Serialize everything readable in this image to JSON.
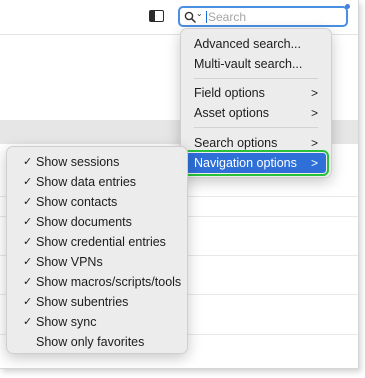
{
  "toolbar": {
    "search_placeholder": "Search",
    "search_chevron": "⌄"
  },
  "main_menu": {
    "items": [
      {
        "label": "Advanced search...",
        "submenu": false
      },
      {
        "label": "Multi-vault search...",
        "submenu": false
      },
      {
        "label": "Field options",
        "submenu": true
      },
      {
        "label": "Asset options",
        "submenu": true
      },
      {
        "label": "Search options",
        "submenu": true
      },
      {
        "label": "Navigation options",
        "submenu": true,
        "highlighted": true
      }
    ],
    "arrow": ">"
  },
  "navigation_submenu": {
    "check_glyph": "✓",
    "items": [
      {
        "label": "Show sessions",
        "checked": true
      },
      {
        "label": "Show data entries",
        "checked": true
      },
      {
        "label": "Show contacts",
        "checked": true
      },
      {
        "label": "Show documents",
        "checked": true
      },
      {
        "label": "Show credential entries",
        "checked": true
      },
      {
        "label": "Show VPNs",
        "checked": true
      },
      {
        "label": "Show macros/scripts/tools",
        "checked": true
      },
      {
        "label": "Show subentries",
        "checked": true
      },
      {
        "label": "Show sync",
        "checked": true
      },
      {
        "label": "Show only favorites",
        "checked": false
      }
    ]
  },
  "colors": {
    "highlight": "#2f6fd8",
    "highlight_outline": "#27c13a",
    "search_focus": "#4a90e2"
  }
}
